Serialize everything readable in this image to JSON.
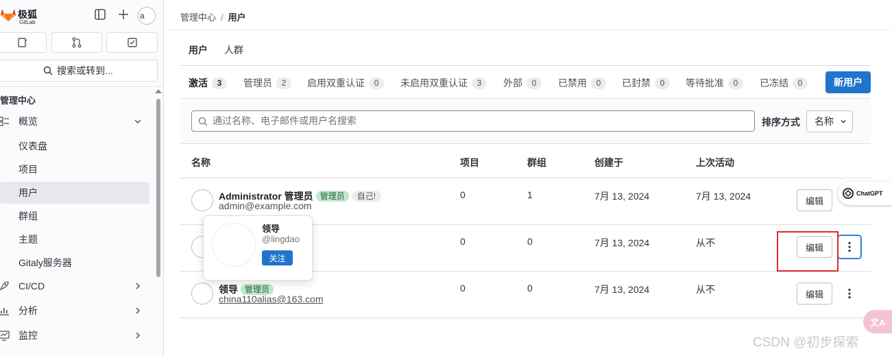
{
  "brand": {
    "name": "极狐",
    "sub": "GitLab"
  },
  "sidebar": {
    "search_label": "搜索或转到...",
    "section_title": "管理中心",
    "items": [
      {
        "label": "概览",
        "icon": "overview-icon",
        "expandable": true
      },
      {
        "label": "仪表盘"
      },
      {
        "label": "项目"
      },
      {
        "label": "用户",
        "active": true
      },
      {
        "label": "群组"
      },
      {
        "label": "主题"
      },
      {
        "label": "Gitaly服务器"
      },
      {
        "label": "CI/CD",
        "icon": "rocket-icon",
        "expandable": true
      },
      {
        "label": "分析",
        "icon": "chart-icon",
        "expandable": true
      },
      {
        "label": "监控",
        "icon": "monitor-icon",
        "expandable": true
      }
    ]
  },
  "breadcrumb": {
    "parent": "管理中心",
    "separator": "/",
    "current": "用户"
  },
  "top_tabs": [
    {
      "label": "用户",
      "active": true
    },
    {
      "label": "人群"
    }
  ],
  "filter_tabs": [
    {
      "label": "激活",
      "count": "3",
      "active": true
    },
    {
      "label": "管理员",
      "count": "2"
    },
    {
      "label": "启用双重认证",
      "count": "0"
    },
    {
      "label": "未启用双重认证",
      "count": "3"
    },
    {
      "label": "外部",
      "count": "0"
    },
    {
      "label": "已禁用",
      "count": "0"
    },
    {
      "label": "已封禁",
      "count": "0"
    },
    {
      "label": "等待批准",
      "count": "0"
    },
    {
      "label": "已冻结",
      "count": "0"
    }
  ],
  "new_user_label": "新用户",
  "search": {
    "placeholder": "通过名称、电子邮件或用户名搜索"
  },
  "sort": {
    "label": "排序方式",
    "value": "名称"
  },
  "table": {
    "headers": [
      "名称",
      "项目",
      "群组",
      "创建于",
      "上次活动"
    ],
    "rows": [
      {
        "name": "Administrator 管理员",
        "badge_admin": "管理员",
        "badge_self": "自己!",
        "email": "admin@example.com",
        "projects": "0",
        "groups": "1",
        "created": "7月 13, 2024",
        "last_active": "7月 13, 2024",
        "edit": "编辑"
      },
      {
        "name": "",
        "email": "",
        "projects": "0",
        "groups": "0",
        "created": "7月 13, 2024",
        "last_active": "从不",
        "edit": "编辑"
      },
      {
        "name": "领导",
        "badge_admin": "管理员",
        "email": "china110alias@163.com",
        "projects": "0",
        "groups": "0",
        "created": "7月 13, 2024",
        "last_active": "从不",
        "edit": "编辑"
      }
    ]
  },
  "popover": {
    "name": "领导",
    "handle": "@lingdao",
    "follow": "关注"
  },
  "overlays": {
    "chatgpt": "ChatGPT",
    "watermark": "CSDN @初步探索"
  },
  "colors": {
    "accent": "#1f75cb",
    "highlight_box": "#e6262b"
  }
}
